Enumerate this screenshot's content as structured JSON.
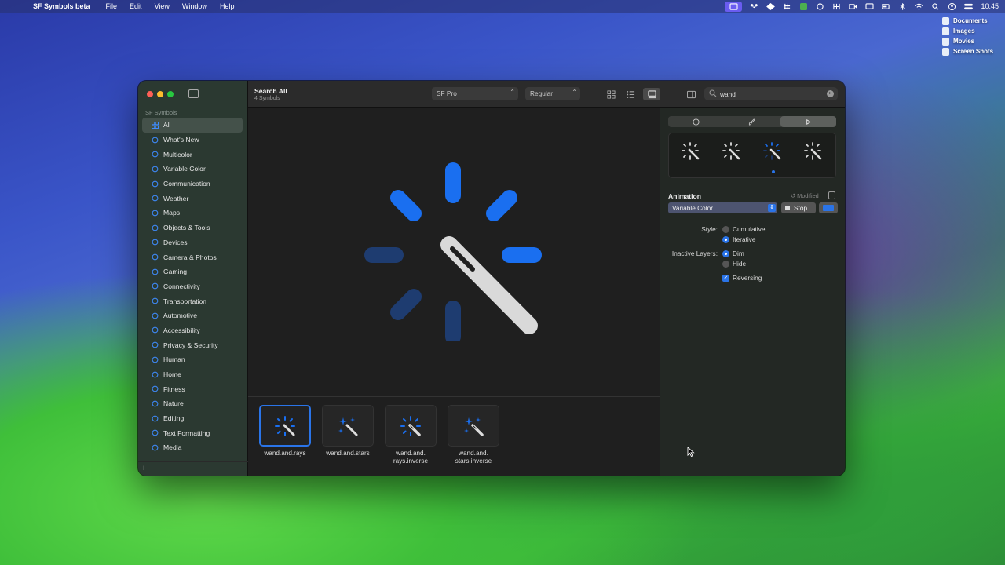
{
  "menubar": {
    "app_name": "SF Symbols beta",
    "items": [
      "File",
      "Edit",
      "View",
      "Window",
      "Help"
    ],
    "clock": "10:45"
  },
  "desktop": {
    "items": [
      "Documents",
      "Images",
      "Movies",
      "Screen Shots"
    ]
  },
  "sidebar": {
    "section": "SF Symbols",
    "items": [
      {
        "label": "All",
        "icon": "grid-icon"
      },
      {
        "label": "What's New",
        "icon": "sparkle-icon"
      },
      {
        "label": "Multicolor",
        "icon": "paintpalette-icon"
      },
      {
        "label": "Variable Color",
        "icon": "variable-color-icon"
      },
      {
        "label": "Communication",
        "icon": "message-icon"
      },
      {
        "label": "Weather",
        "icon": "cloud-icon"
      },
      {
        "label": "Maps",
        "icon": "map-icon"
      },
      {
        "label": "Objects & Tools",
        "icon": "folder-icon"
      },
      {
        "label": "Devices",
        "icon": "desktop-icon"
      },
      {
        "label": "Camera & Photos",
        "icon": "camera-icon"
      },
      {
        "label": "Gaming",
        "icon": "gamecontroller-icon"
      },
      {
        "label": "Connectivity",
        "icon": "antenna-icon"
      },
      {
        "label": "Transportation",
        "icon": "car-icon"
      },
      {
        "label": "Automotive",
        "icon": "engine-icon"
      },
      {
        "label": "Accessibility",
        "icon": "accessibility-icon"
      },
      {
        "label": "Privacy & Security",
        "icon": "lock-icon"
      },
      {
        "label": "Human",
        "icon": "person-icon"
      },
      {
        "label": "Home",
        "icon": "house-icon"
      },
      {
        "label": "Fitness",
        "icon": "figure-run-icon"
      },
      {
        "label": "Nature",
        "icon": "leaf-icon"
      },
      {
        "label": "Editing",
        "icon": "slider-icon"
      },
      {
        "label": "Text Formatting",
        "icon": "textformat-icon"
      },
      {
        "label": "Media",
        "icon": "playpause-icon"
      }
    ]
  },
  "toolbar": {
    "title": "Search All",
    "subtitle": "4 Symbols",
    "font_popup": "SF Pro",
    "weight_popup": "Regular",
    "search_value": "wand"
  },
  "gallery": {
    "symbols": [
      {
        "name": "wand.and.rays"
      },
      {
        "name": "wand.and.stars"
      },
      {
        "name": "wand.and.\nrays.inverse"
      },
      {
        "name": "wand.and.\nstars.inverse"
      }
    ]
  },
  "inspector": {
    "animation_label": "Animation",
    "modified_label": "Modified",
    "animation_select": "Variable Color",
    "stop_label": "Stop",
    "style_label": "Style:",
    "style_options": [
      "Cumulative",
      "Iterative"
    ],
    "style_selected": "Iterative",
    "inactive_label": "Inactive Layers:",
    "inactive_options": [
      "Dim",
      "Hide"
    ],
    "inactive_selected": "Dim",
    "reversing_label": "Reversing",
    "reversing_checked": true
  },
  "colors": {
    "accent": "#2a74e8",
    "symbol_active_blue": "#1a6ff0",
    "symbol_dim_blue": "#1e3c70",
    "wand_white": "#d9d9d9"
  }
}
